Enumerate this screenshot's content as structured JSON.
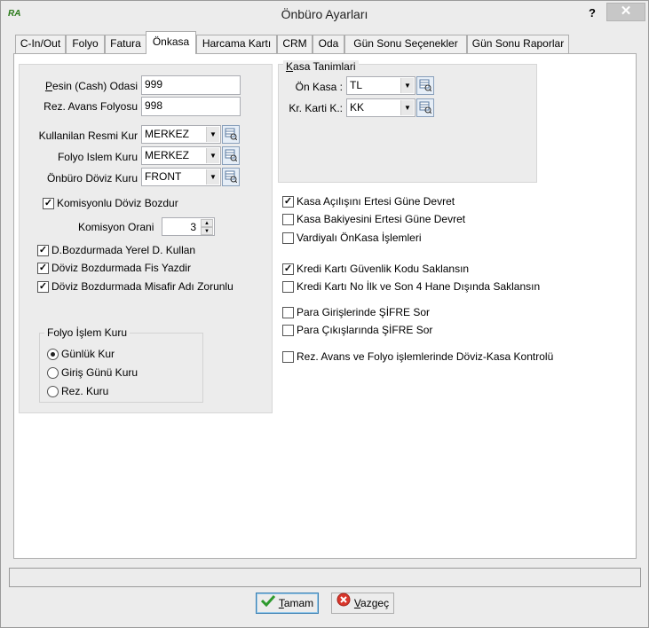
{
  "window": {
    "title": "Önbüro Ayarları",
    "app_icon_text": "RA",
    "help_label": "?",
    "close_label": "✕"
  },
  "tabs": [
    {
      "label": "C-In/Out"
    },
    {
      "label": "Folyo"
    },
    {
      "label": "Fatura"
    },
    {
      "label": "Önkasa",
      "active": true
    },
    {
      "label": "Harcama Kartı"
    },
    {
      "label": "CRM"
    },
    {
      "label": "Oda"
    },
    {
      "label": "Gün Sonu Seçenekler"
    },
    {
      "label": "Gün Sonu Raporlar"
    }
  ],
  "left": {
    "pesin_label_u": "P",
    "pesin_label_rest": "esin (Cash) Odasi",
    "pesin_value": "999",
    "rez_label": "Rez. Avans Folyosu",
    "rez_value": "998",
    "resmi_kur_label": "Kullanilan Resmi Kur",
    "resmi_kur_value": "MERKEZ",
    "folyo_islem_label": "Folyo Islem Kuru",
    "folyo_islem_value": "MERKEZ",
    "doviz_kuru_label": "Önbüro Döviz Kuru",
    "doviz_kuru_value": "FRONT",
    "komisyonlu_label": "Komisyonlu Döviz Bozdur",
    "komisyonlu_checked": true,
    "komisyon_orani_label": "Komisyon Orani",
    "komisyon_orani_value": "3",
    "yerel_label": "D.Bozdurmada Yerel D. Kullan",
    "yerel_checked": true,
    "fis_label": "Döviz Bozdurmada Fis Yazdir",
    "fis_checked": true,
    "misafir_label": "Döviz Bozdurmada Misafir Adı Zorunlu",
    "misafir_checked": true
  },
  "folyo_kur_group": {
    "legend": "Folyo İşlem Kuru",
    "options": [
      {
        "label": "Günlük Kur",
        "selected": true
      },
      {
        "label": "Giriş Günü Kuru",
        "selected": false
      },
      {
        "label": "Rez. Kuru",
        "selected": false
      }
    ]
  },
  "kasa": {
    "legend_u": "K",
    "legend_rest": "asa Tanimlari",
    "on_kasa_label": "Ön Kasa :",
    "on_kasa_value": "TL",
    "kr_karti_label": "Kr. Karti K.:",
    "kr_karti_value": "KK"
  },
  "right_checks": [
    {
      "label": "Kasa Açılışını Ertesi Güne Devret",
      "checked": true
    },
    {
      "label": "Kasa Bakiyesini Ertesi Güne Devret",
      "checked": false
    },
    {
      "label": "Vardiyalı ÖnKasa İşlemleri",
      "checked": false
    },
    {
      "label": "Kredi Kartı Güvenlik Kodu Saklansın",
      "checked": true
    },
    {
      "label": "Kredi Kartı No İlk ve Son 4 Hane Dışında Saklansın",
      "checked": false
    },
    {
      "label": "Para Girişlerinde ŞİFRE Sor",
      "checked": false
    },
    {
      "label": "Para Çıkışlarında ŞİFRE Sor",
      "checked": false
    },
    {
      "label": "Rez. Avans ve Folyo işlemlerinde Döviz-Kasa Kontrolü",
      "checked": false
    }
  ],
  "buttons": {
    "ok_u": "T",
    "ok_rest": "amam",
    "cancel_u": "V",
    "cancel_rest": "azgeç"
  }
}
